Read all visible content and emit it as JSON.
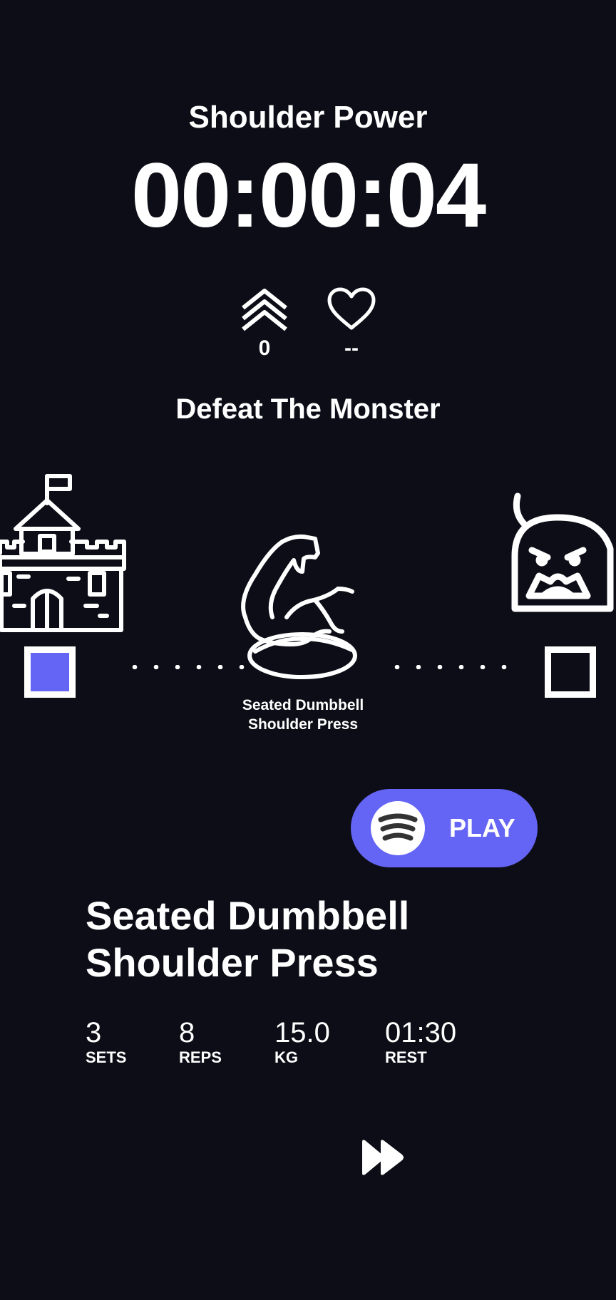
{
  "header": {
    "workout_title": "Shoulder Power",
    "timer": "00:00:04"
  },
  "stats": {
    "level_value": "0",
    "heart_rate_value": "--"
  },
  "challenge": {
    "title": "Defeat The Monster"
  },
  "journey": {
    "current_exercise_caption": "Seated Dumbbell Shoulder Press",
    "accent_color": "#6464f5"
  },
  "music": {
    "play_label": "PLAY"
  },
  "exercise": {
    "name": "Seated Dumbbell Shoulder Press",
    "metrics": [
      {
        "value": "3",
        "label": "SETS"
      },
      {
        "value": "8",
        "label": "REPS"
      },
      {
        "value": "15.0",
        "label": "KG"
      },
      {
        "value": "01:30",
        "label": "REST"
      }
    ]
  },
  "controls": {
    "skip_icon": "fast-forward-icon"
  },
  "theme": {
    "background": "#0d0d17",
    "accent": "#6464f5",
    "text": "#ffffff"
  }
}
